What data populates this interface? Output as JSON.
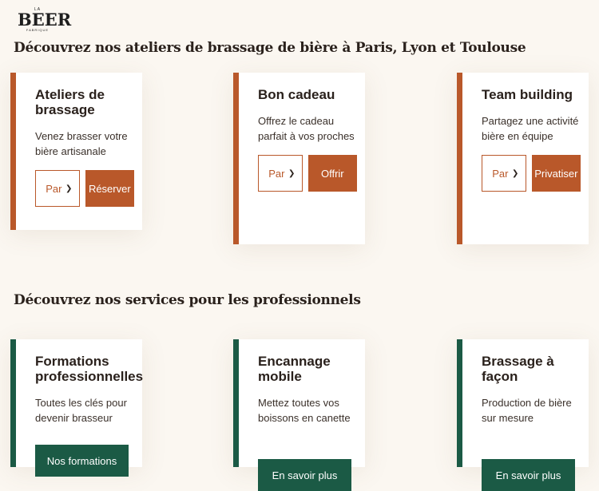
{
  "brand": {
    "la": "LA",
    "name": "BEER",
    "sub": "FABRIQUE"
  },
  "headings": {
    "workshops": "Découvrez nos ateliers de brassage de bière à Paris, Lyon et Toulouse",
    "pro": "Découvrez nos services pour les professionnels"
  },
  "cards": [
    {
      "title": "Ateliers de brassage",
      "desc": "Venez brasser votre bière artisanale",
      "select": "Par",
      "button": "Réserver"
    },
    {
      "title": "Bon cadeau",
      "desc": "Offrez le cadeau parfait à vos proches",
      "select": "Par",
      "button": "Offrir"
    },
    {
      "title": "Team building",
      "desc": "Partagez une activité bière en équipe",
      "select": "Par",
      "button": "Privatiser"
    }
  ],
  "pro_cards": [
    {
      "title": "Formations professionnelles",
      "desc": "Toutes les clés pour devenir brasseur",
      "button": "Nos formations"
    },
    {
      "title": "Encannage mobile",
      "desc": "Mettez toutes vos boissons en canette",
      "button": "En savoir plus"
    },
    {
      "title": "Brassage à façon",
      "desc": "Production de bière sur mesure",
      "button": "En savoir plus"
    }
  ],
  "colors": {
    "brown": "#b9582a",
    "green": "#1b5a45",
    "background": "#fbf7f1"
  },
  "icons": {
    "select_chevron": "chevron-down-icon"
  }
}
